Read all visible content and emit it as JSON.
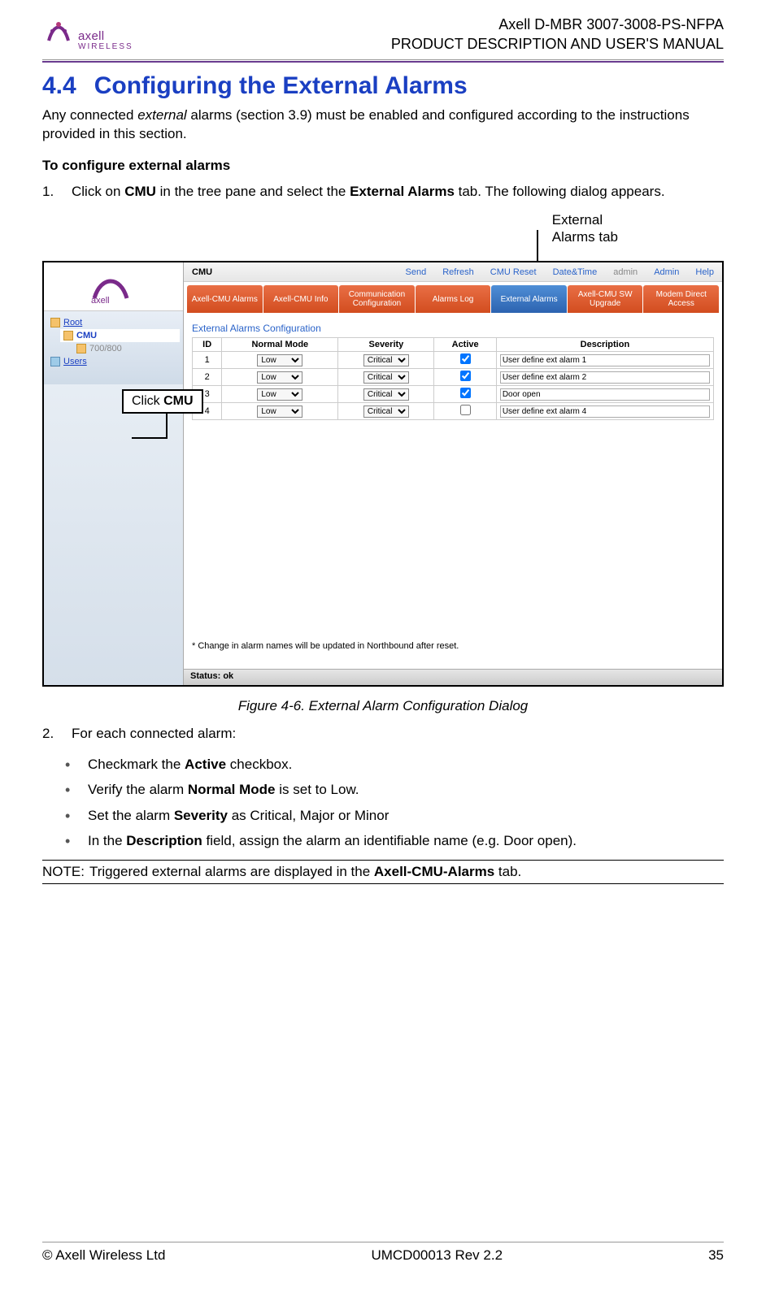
{
  "header": {
    "brand": "axell",
    "brand_sub": "WIRELESS",
    "doc_line1": "Axell D-MBR 3007-3008-PS-NFPA",
    "doc_line2": "PRODUCT DESCRIPTION AND USER'S MANUAL"
  },
  "title": {
    "number": "4.4",
    "text": "Configuring the External Alarms"
  },
  "intro": {
    "p1a": "Any connected ",
    "p1_em": "external",
    "p1b": " alarms (section 3.9) must be enabled and configured according to the instructions provided in this section."
  },
  "subhead": "To configure external alarms",
  "steps": {
    "s1a": "Click on ",
    "s1_b1": "CMU",
    "s1b": " in the tree pane and select the ",
    "s1_b2": "External Alarms",
    "s1c": " tab. The following dialog appears.",
    "s2": "For each connected alarm:"
  },
  "callouts": {
    "ext_tab_l1": "External",
    "ext_tab_l2": "Alarms tab",
    "click_cmu_a": "Click ",
    "click_cmu_b": "CMU"
  },
  "figure_caption": "Figure 4-6. External Alarm Configuration Dialog",
  "bullets": {
    "b1a": "Checkmark the ",
    "b1b": "Active",
    "b1c": " checkbox.",
    "b2a": "Verify the alarm ",
    "b2b": "Normal Mode",
    "b2c": " is set to Low.",
    "b3a": "Set the alarm ",
    "b3b": "Severity",
    "b3c": " as Critical, Major or Minor",
    "b4a": "In the ",
    "b4b": "Description",
    "b4c": " field, assign the alarm an identifiable name (e.g. Door open)."
  },
  "note": {
    "label": "NOTE:",
    "t1": "Triggered external alarms are displayed in the ",
    "t2": "Axell-CMU-Alarms",
    "t3": " tab."
  },
  "footer": {
    "left": "© Axell Wireless Ltd",
    "mid": "UMCD00013 Rev 2.2",
    "right": "35"
  },
  "screenshot": {
    "topbar": {
      "title": "CMU",
      "send": "Send",
      "refresh": "Refresh",
      "reset": "CMU Reset",
      "datetime": "Date&Time",
      "admin_label": "admin",
      "admin_link": "Admin",
      "help": "Help"
    },
    "tabs": [
      "Axell-CMU Alarms",
      "Axell-CMU Info",
      "Communication Configuration",
      "Alarms Log",
      "External Alarms",
      "Axell-CMU SW Upgrade",
      "Modem Direct Access"
    ],
    "active_tab_index": 4,
    "tree": {
      "root": "Root",
      "cmu": "CMU",
      "band": "700/800",
      "users": "Users"
    },
    "panel_title": "External Alarms Configuration",
    "cols": {
      "id": "ID",
      "normal": "Normal Mode",
      "sev": "Severity",
      "active": "Active",
      "desc": "Description"
    },
    "rows": [
      {
        "id": "1",
        "normal": "Low",
        "sev": "Critical",
        "active": true,
        "desc": "User define ext alarm 1"
      },
      {
        "id": "2",
        "normal": "Low",
        "sev": "Critical",
        "active": true,
        "desc": "User define ext alarm 2"
      },
      {
        "id": "3",
        "normal": "Low",
        "sev": "Critical",
        "active": true,
        "desc": "Door open"
      },
      {
        "id": "4",
        "normal": "Low",
        "sev": "Critical",
        "active": false,
        "desc": "User define ext alarm 4"
      }
    ],
    "footnote": "* Change in alarm names will be updated in Northbound after reset.",
    "status": "Status: ok"
  }
}
